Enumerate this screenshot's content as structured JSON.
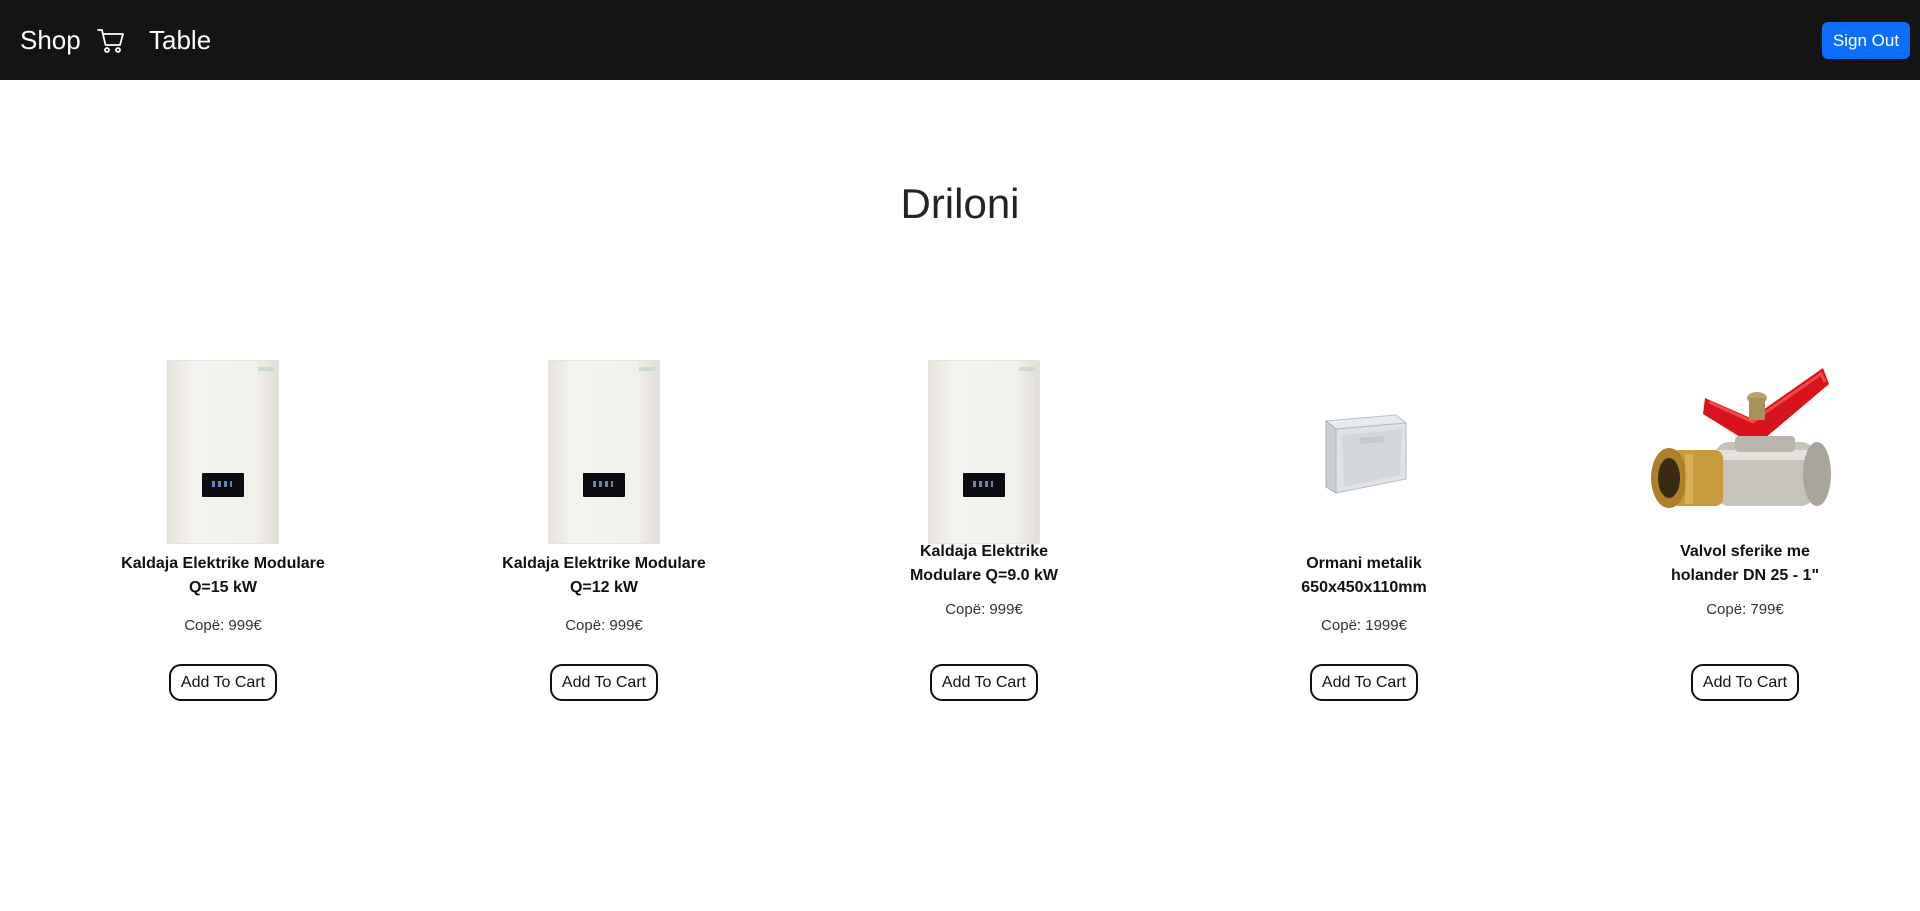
{
  "nav": {
    "brand": "Shop",
    "table_link": "Table",
    "sign_out": "Sign Out",
    "cart_icon": "shopping-cart-icon"
  },
  "page": {
    "title": "Driloni"
  },
  "products": [
    {
      "name": "Kaldaja Elektrike Modulare Q=15 kW",
      "price": "Copë: 999€",
      "button": "Add To Cart",
      "image": "electric-boiler"
    },
    {
      "name": "Kaldaja Elektrike Modulare Q=12 kW",
      "price": "Copë: 999€",
      "button": "Add To Cart",
      "image": "electric-boiler"
    },
    {
      "name": "Kaldaja Elektrike Modulare Q=9.0 kW",
      "price": "Copë: 999€",
      "button": "Add To Cart",
      "image": "electric-boiler"
    },
    {
      "name": "Ormani metalik 650x450x110mm",
      "price": "Copë: 1999€",
      "button": "Add To Cart",
      "image": "metal-cabinet"
    },
    {
      "name": "Valvol sferike me holander DN 25 - 1\"",
      "price": "Copë: 799€",
      "button": "Add To Cart",
      "image": "ball-valve"
    }
  ],
  "colors": {
    "navbar_bg": "#141414",
    "primary": "#0d6efd"
  }
}
